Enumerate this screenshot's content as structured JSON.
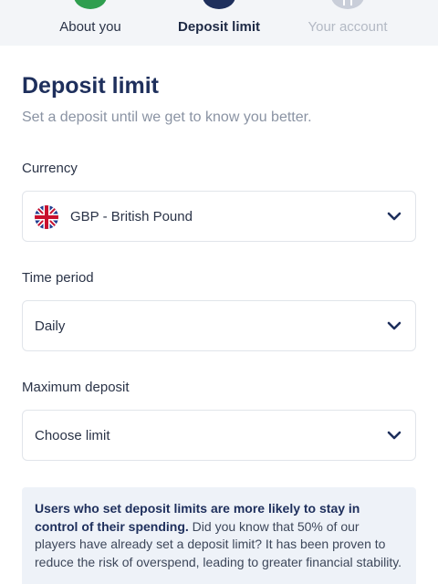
{
  "stepper": {
    "steps": [
      {
        "label": "About you",
        "state": "completed",
        "color": "#2f9e4f"
      },
      {
        "label": "Deposit limit",
        "state": "active",
        "color": "#1e2f5c"
      },
      {
        "label": "Your account",
        "state": "upcoming",
        "color": "#c9ced9"
      }
    ]
  },
  "page": {
    "title": "Deposit limit",
    "subtitle": "Set a deposit until we get to know you better."
  },
  "form": {
    "currency": {
      "label": "Currency",
      "value": "GBP - British Pound",
      "flag_icon": "uk-flag-icon"
    },
    "time_period": {
      "label": "Time period",
      "value": "Daily"
    },
    "max_deposit": {
      "label": "Maximum deposit",
      "placeholder": "Choose limit"
    }
  },
  "info": {
    "bold": "Users who set deposit limits are more likely to stay in control of their spending.",
    "text": " Did you know that 50% of our players have already set a deposit limit? It has been proven to reduce the risk of overspend, leading to greater financial stability."
  }
}
